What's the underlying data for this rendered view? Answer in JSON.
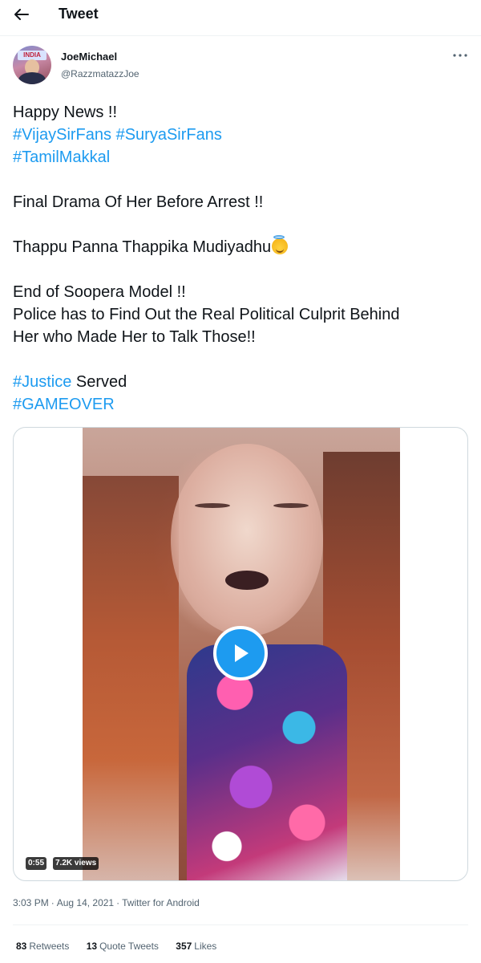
{
  "header": {
    "title": "Tweet"
  },
  "author": {
    "display_name": "JoeMichael",
    "handle": "@RazzmatazzJoe",
    "avatar_banner_text": "INDIA"
  },
  "tweet": {
    "lines": [
      {
        "type": "text",
        "text": "Happy News !!"
      },
      {
        "type": "hashtags",
        "tags": [
          "#VijaySirFans",
          "#SuryaSirFans"
        ]
      },
      {
        "type": "hashtags",
        "tags": [
          "#TamilMakkal"
        ]
      },
      {
        "type": "gap"
      },
      {
        "type": "text",
        "text": "Final Drama Of Her Before Arrest !!"
      },
      {
        "type": "gap"
      },
      {
        "type": "text",
        "text": "Thappu Panna Thappika Mudiyadhu",
        "emoji": "smiling-face-with-halo"
      },
      {
        "type": "gap"
      },
      {
        "type": "text",
        "text": "End of Soopera Model !!"
      },
      {
        "type": "text",
        "text": "Police has to Find Out the Real Political Culprit Behind"
      },
      {
        "type": "text",
        "text": "Her who Made Her to Talk Those!!"
      },
      {
        "type": "gap"
      },
      {
        "type": "mixed",
        "tag": "#Justice",
        "text": " Served"
      },
      {
        "type": "hashtags",
        "tags": [
          "#GAMEOVER"
        ]
      }
    ]
  },
  "media": {
    "duration": "0:55",
    "views": "7.2K views"
  },
  "meta": {
    "time": "3:03 PM",
    "date": "Aug 14, 2021",
    "separator": "·",
    "source": "Twitter for Android"
  },
  "stats": {
    "retweets_count": "83",
    "retweets_label": "Retweets",
    "quote_count": "13",
    "quote_label": "Quote Tweets",
    "likes_count": "357",
    "likes_label": "Likes"
  },
  "colors": {
    "accent": "#1d9bf0",
    "text": "#0f1419",
    "secondary": "#536471",
    "border": "#cfd9de"
  },
  "icons": {
    "back": "arrow-left-icon",
    "more": "more-horizontal-icon",
    "play": "play-icon"
  }
}
